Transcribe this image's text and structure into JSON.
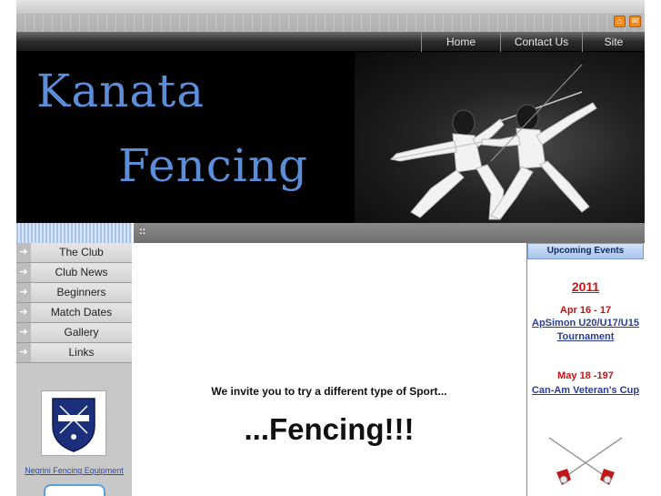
{
  "nav": {
    "home": "Home",
    "contact": "Contact Us",
    "sitemap": "Site map"
  },
  "banner": {
    "line1": "Kanata",
    "line2": "Fencing"
  },
  "strip": {
    "dots": "::"
  },
  "sidebar": {
    "items": [
      {
        "label": "The Club"
      },
      {
        "label": "Club News"
      },
      {
        "label": "Beginners"
      },
      {
        "label": "Match Dates"
      },
      {
        "label": "Gallery"
      },
      {
        "label": "Links"
      }
    ],
    "logo_icon": "negrini-crest-icon",
    "equipment_link": "Negrini Fencing Equipment"
  },
  "main": {
    "invite": "We invite you to try a different type of Sport...",
    "headline": "...Fencing!!!"
  },
  "events": {
    "heading": "Upcoming Events",
    "year": "2011",
    "items": [
      {
        "date": "Apr 16  - 17",
        "title": "ApSimon U20/U17/U15 Tournament"
      },
      {
        "date": "May 18 -197",
        "title": "Can-Am Veteran's Cup"
      }
    ]
  },
  "colors": {
    "banner_text": "#5b8ed8",
    "event_date": "#cc1111",
    "event_link": "#2a3e96",
    "icon_orange": "#f08a1c"
  }
}
